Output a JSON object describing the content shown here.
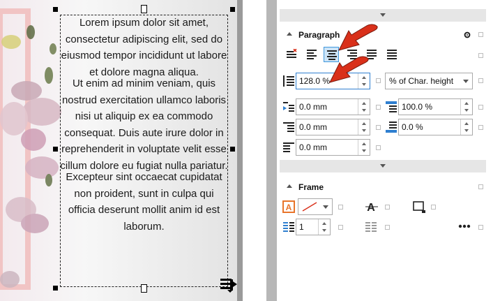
{
  "canvas": {
    "paragraphs": [
      "Lorem ipsum dolor sit amet, consectetur adipiscing elit, sed do eiusmod tempor incididunt ut labore et dolore magna aliqua.",
      "Ut enim ad minim veniam, quis nostrud exercitation ullamco laboris nisi ut aliquip ex ea commodo consequat. Duis aute irure dolor in reprehenderit in voluptate velit esse cillum dolore eu fugiat nulla pariatur.",
      "Excepteur sint occaecat cupidatat non proident, sunt in culpa qui officia deserunt mollit anim id est laborum."
    ]
  },
  "panel": {
    "paragraph_section": {
      "title": "Paragraph",
      "alignment_icons": [
        "no-alignment-icon",
        "align-left-icon",
        "align-center-icon",
        "align-right-icon",
        "justify-icon",
        "force-justify-icon"
      ],
      "active_alignment": "align-center-icon",
      "line_spacing": {
        "value": "128.0 %",
        "unit": "% of Char. height"
      },
      "indent_first_line": "0.0 mm",
      "indent_left": "0.0 mm",
      "indent_right": "0.0 mm",
      "space_before": "100.0 %",
      "space_after": "0.0 %"
    },
    "frame_section": {
      "title": "Frame",
      "columns": "1"
    },
    "colors": {
      "accent": "#2f7fd0",
      "active_bg": "#cde4f7",
      "annotation_arrow": "#d9301a",
      "frame_icon": "#e8742a"
    }
  }
}
